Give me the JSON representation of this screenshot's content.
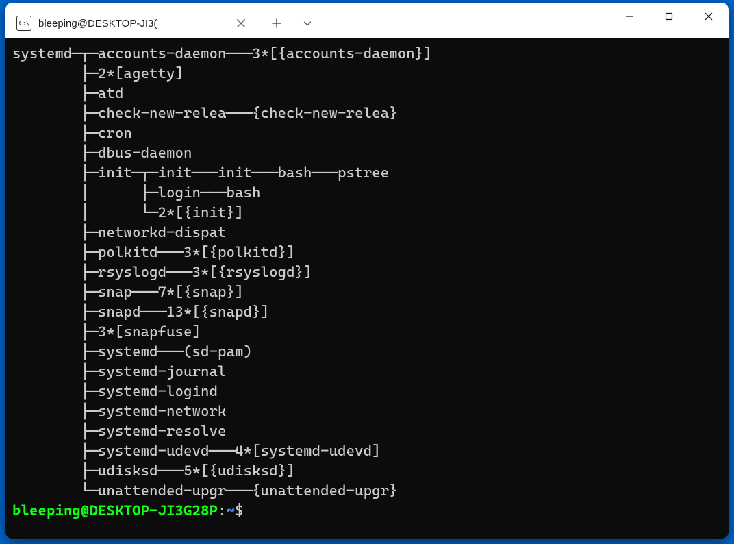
{
  "titlebar": {
    "tab_icon_text": "C:\\",
    "tab_title": "bleeping@DESKTOP-JI3(",
    "close_label": "Close",
    "newtab_label": "New tab",
    "dropdown_label": "Tab options"
  },
  "window_controls": {
    "minimize": "Minimize",
    "maximize": "Maximize",
    "close": "Close"
  },
  "terminal": {
    "lines": [
      "systemd─┬─accounts-daemon───3*[{accounts-daemon}]",
      "        ├─2*[agetty]",
      "        ├─atd",
      "        ├─check-new-relea───{check-new-relea}",
      "        ├─cron",
      "        ├─dbus-daemon",
      "        ├─init─┬─init───init───bash───pstree",
      "        │      ├─login───bash",
      "        │      └─2*[{init}]",
      "        ├─networkd-dispat",
      "        ├─polkitd───3*[{polkitd}]",
      "        ├─rsyslogd───3*[{rsyslogd}]",
      "        ├─snap───7*[{snap}]",
      "        ├─snapd───13*[{snapd}]",
      "        ├─3*[snapfuse]",
      "        ├─systemd───(sd-pam)",
      "        ├─systemd-journal",
      "        ├─systemd-logind",
      "        ├─systemd-network",
      "        ├─systemd-resolve",
      "        ├─systemd-udevd───4*[systemd-udevd]",
      "        ├─udisksd───5*[{udisksd}]",
      "        └─unattended-upgr───{unattended-upgr}"
    ],
    "prompt": {
      "user_host": "bleeping@DESKTOP-JI3G28P",
      "colon": ":",
      "path": "~",
      "symbol": "$"
    }
  }
}
